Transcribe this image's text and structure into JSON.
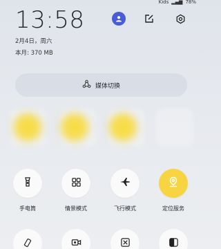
{
  "status": {
    "label": "Kids",
    "battery": "78%"
  },
  "clock": {
    "time": "13:58",
    "date": "2月4日，周六",
    "data_usage": "本月: 370 MB"
  },
  "header_icons": [
    "avatar-icon",
    "edit-icon",
    "settings-icon"
  ],
  "media": {
    "label": "媒体切换",
    "icon": "media-switch-icon"
  },
  "tiles": [
    {
      "label": "手电筒",
      "icon": "flashlight-icon",
      "active": false
    },
    {
      "label": "情景模式",
      "icon": "scene-mode-icon",
      "active": false
    },
    {
      "label": "飞行模式",
      "icon": "airplane-icon",
      "active": false
    },
    {
      "label": "定位服务",
      "icon": "location-icon",
      "active": true
    }
  ],
  "tiles_row2": [
    "auto-rotate-icon",
    "screen-record-icon",
    "screenshot-icon",
    "dark-mode-icon"
  ],
  "colors": {
    "accent": "#f7d542",
    "avatar": "#4a5bd8"
  }
}
